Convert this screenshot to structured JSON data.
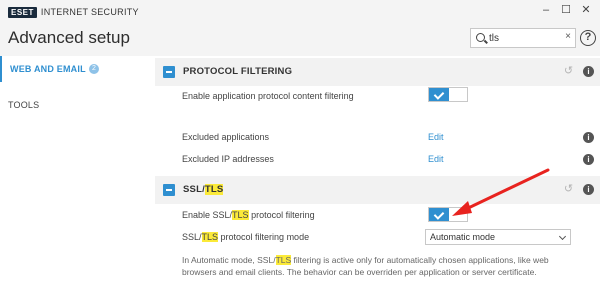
{
  "titlebar": {
    "logo_text": "ESET",
    "app_name": "INTERNET SECURITY",
    "minimize": "–",
    "maximize": "☐",
    "close": "✕"
  },
  "header": {
    "title": "Advanced setup",
    "search_value": "tls",
    "search_clear": "×",
    "help": "?"
  },
  "sidebar": {
    "items": [
      {
        "label": "WEB AND EMAIL",
        "badge": "2",
        "active": true
      },
      {
        "label": "TOOLS",
        "active": false
      }
    ]
  },
  "sections": {
    "protocol": {
      "title": "PROTOCOL FILTERING",
      "rows": [
        {
          "label": "Enable application protocol content filtering",
          "toggle": "on"
        },
        {
          "label": "Excluded applications",
          "link": "Edit",
          "info": "i"
        },
        {
          "label": "Excluded IP addresses",
          "link": "Edit",
          "info": "i"
        }
      ],
      "info": "i"
    },
    "ssl": {
      "title_prefix": "SSL/",
      "title_highlight": "TLS",
      "info": "i",
      "enable_row": {
        "prefix": "Enable SSL/",
        "highlight": "TLS",
        "suffix": " protocol filtering",
        "toggle": "on"
      },
      "mode_row": {
        "prefix": "SSL/",
        "highlight": "TLS",
        "suffix": " protocol filtering mode",
        "value": "Automatic mode"
      },
      "note_prefix": "In Automatic mode, SSL/",
      "note_highlight": "TLS",
      "note_suffix": " filtering is active only for automatically chosen applications, like web browsers and email clients. The behavior can be overriden per application or server certificate."
    }
  },
  "colors": {
    "accent": "#2f8fd0",
    "highlight": "#fbea39",
    "annotation_arrow": "#e8231f"
  }
}
